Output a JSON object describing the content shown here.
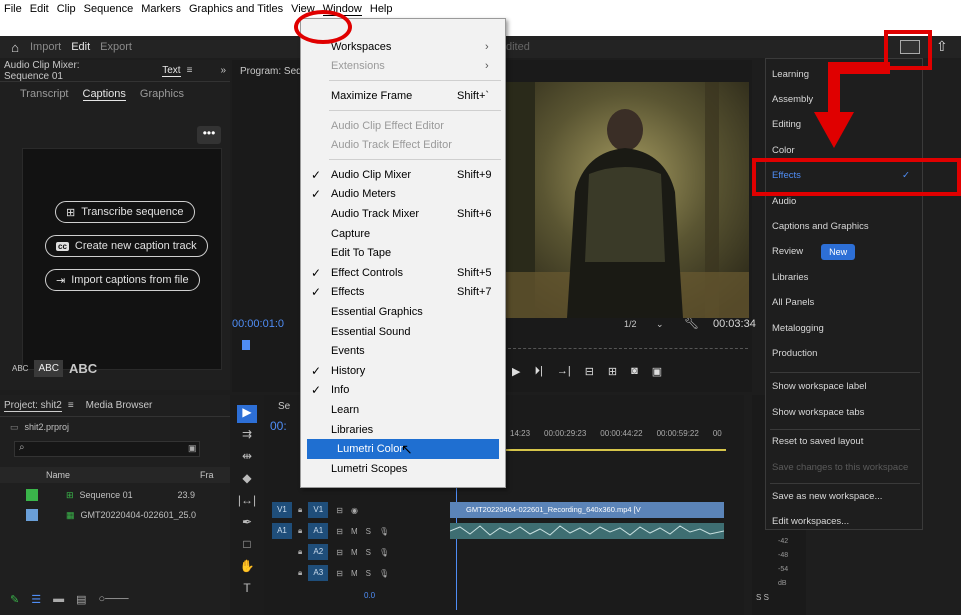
{
  "menubar": {
    "items": [
      "File",
      "Edit",
      "Clip",
      "Sequence",
      "Markers",
      "Graphics and Titles",
      "View",
      "Window",
      "Help"
    ],
    "active": "Window"
  },
  "header": {
    "home_icon": "home-icon",
    "modes": [
      "Import",
      "Edit",
      "Export"
    ],
    "active_mode": "Edit",
    "title_suffix": "dited"
  },
  "left_panel": {
    "top_tabs": [
      "Audio Clip Mixer: Sequence 01",
      "Text"
    ],
    "overflow": "»",
    "sub_tabs": [
      "Transcript",
      "Captions",
      "Graphics"
    ],
    "active_sub_tab": "Captions",
    "more_button": "•••",
    "buttons": [
      {
        "label": "Transcribe sequence",
        "icon": "transcribe-icon"
      },
      {
        "label": "Create new caption track",
        "icon": "cc-icon"
      },
      {
        "label": "Import captions from file",
        "icon": "import-icon"
      }
    ],
    "abc_sizes": [
      "ABC",
      "ABC",
      "ABC"
    ]
  },
  "program": {
    "title": "Program: Seque",
    "timecode_left": "00:00:01:0",
    "timecode_right": "00:03:34",
    "zoom": "1/2"
  },
  "project": {
    "tabs": [
      "Project: shit2",
      "Media Browser"
    ],
    "file": "shit2.prproj",
    "columns": [
      "Name",
      "Fra"
    ],
    "rows": [
      {
        "name": "Sequence 01",
        "fps": "23.9",
        "color": "#3ab54a"
      },
      {
        "name": "GMT20220404-022601_Rec",
        "fps": "25.0",
        "color": "#6a9fd8"
      }
    ]
  },
  "timeline": {
    "tab": "Se",
    "timecode": "00:",
    "ruler": [
      "14:23",
      "00:00:29:23",
      "00:00:44:22",
      "00:00:59:22",
      "00"
    ],
    "tracks": [
      "V1",
      "A1",
      "A2",
      "A3"
    ],
    "track_flags": [
      "M",
      "S"
    ],
    "clip_label": "GMT20220404-022601_Recording_640x360.mp4 [V",
    "mix_value": "0.0"
  },
  "meters": {
    "scale": [
      "-42",
      "-48",
      "-54",
      "dB"
    ],
    "solo": [
      "S",
      "S"
    ]
  },
  "window_menu": {
    "items": [
      {
        "label": "Workspaces",
        "shortcut": "",
        "checked": false,
        "disabled": false,
        "submenu": true
      },
      {
        "label": "Extensions",
        "shortcut": "",
        "checked": false,
        "disabled": true,
        "submenu": true
      },
      {
        "label": "Maximize Frame",
        "shortcut": "Shift+`",
        "checked": false,
        "disabled": false
      },
      {
        "label": "Audio Clip Effect Editor",
        "shortcut": "",
        "checked": false,
        "disabled": true
      },
      {
        "label": "Audio Track Effect Editor",
        "shortcut": "",
        "checked": false,
        "disabled": true
      },
      {
        "label": "Audio Clip Mixer",
        "shortcut": "Shift+9",
        "checked": true,
        "disabled": false
      },
      {
        "label": "Audio Meters",
        "shortcut": "",
        "checked": true,
        "disabled": false
      },
      {
        "label": "Audio Track Mixer",
        "shortcut": "Shift+6",
        "checked": false,
        "disabled": false
      },
      {
        "label": "Capture",
        "shortcut": "",
        "checked": false,
        "disabled": false
      },
      {
        "label": "Edit To Tape",
        "shortcut": "",
        "checked": false,
        "disabled": false
      },
      {
        "label": "Effect Controls",
        "shortcut": "Shift+5",
        "checked": true,
        "disabled": false
      },
      {
        "label": "Effects",
        "shortcut": "Shift+7",
        "checked": true,
        "disabled": false
      },
      {
        "label": "Essential Graphics",
        "shortcut": "",
        "checked": false,
        "disabled": false
      },
      {
        "label": "Essential Sound",
        "shortcut": "",
        "checked": false,
        "disabled": false
      },
      {
        "label": "Events",
        "shortcut": "",
        "checked": false,
        "disabled": false
      },
      {
        "label": "History",
        "shortcut": "",
        "checked": true,
        "disabled": false
      },
      {
        "label": "Info",
        "shortcut": "",
        "checked": true,
        "disabled": false
      },
      {
        "label": "Learn",
        "shortcut": "",
        "checked": false,
        "disabled": false
      },
      {
        "label": "Libraries",
        "shortcut": "",
        "checked": false,
        "disabled": false
      },
      {
        "label": "Lumetri Color",
        "shortcut": "",
        "checked": false,
        "disabled": false,
        "highlighted": true
      },
      {
        "label": "Lumetri Scopes",
        "shortcut": "",
        "checked": false,
        "disabled": false
      }
    ]
  },
  "workspace_menu": {
    "items": [
      {
        "label": "Learning"
      },
      {
        "label": "Assembly"
      },
      {
        "label": "Editing"
      },
      {
        "label": "Color"
      },
      {
        "label": "Effects",
        "selected": true
      },
      {
        "label": "Audio"
      },
      {
        "label": "Captions and Graphics"
      },
      {
        "label": "Review",
        "badge": "New"
      },
      {
        "label": "Libraries"
      },
      {
        "label": "All Panels"
      },
      {
        "label": "Metalogging"
      },
      {
        "label": "Production"
      },
      {
        "label": "Show workspace label"
      },
      {
        "label": "Show workspace tabs"
      },
      {
        "label": "Reset to saved layout"
      },
      {
        "label": "Save changes to this workspace",
        "disabled": true
      },
      {
        "label": "Save as new workspace..."
      },
      {
        "label": "Edit workspaces..."
      }
    ]
  },
  "colors": {
    "accent": "#2d6fd6",
    "annotation": "#e00000",
    "clip": "#5b84b8"
  }
}
